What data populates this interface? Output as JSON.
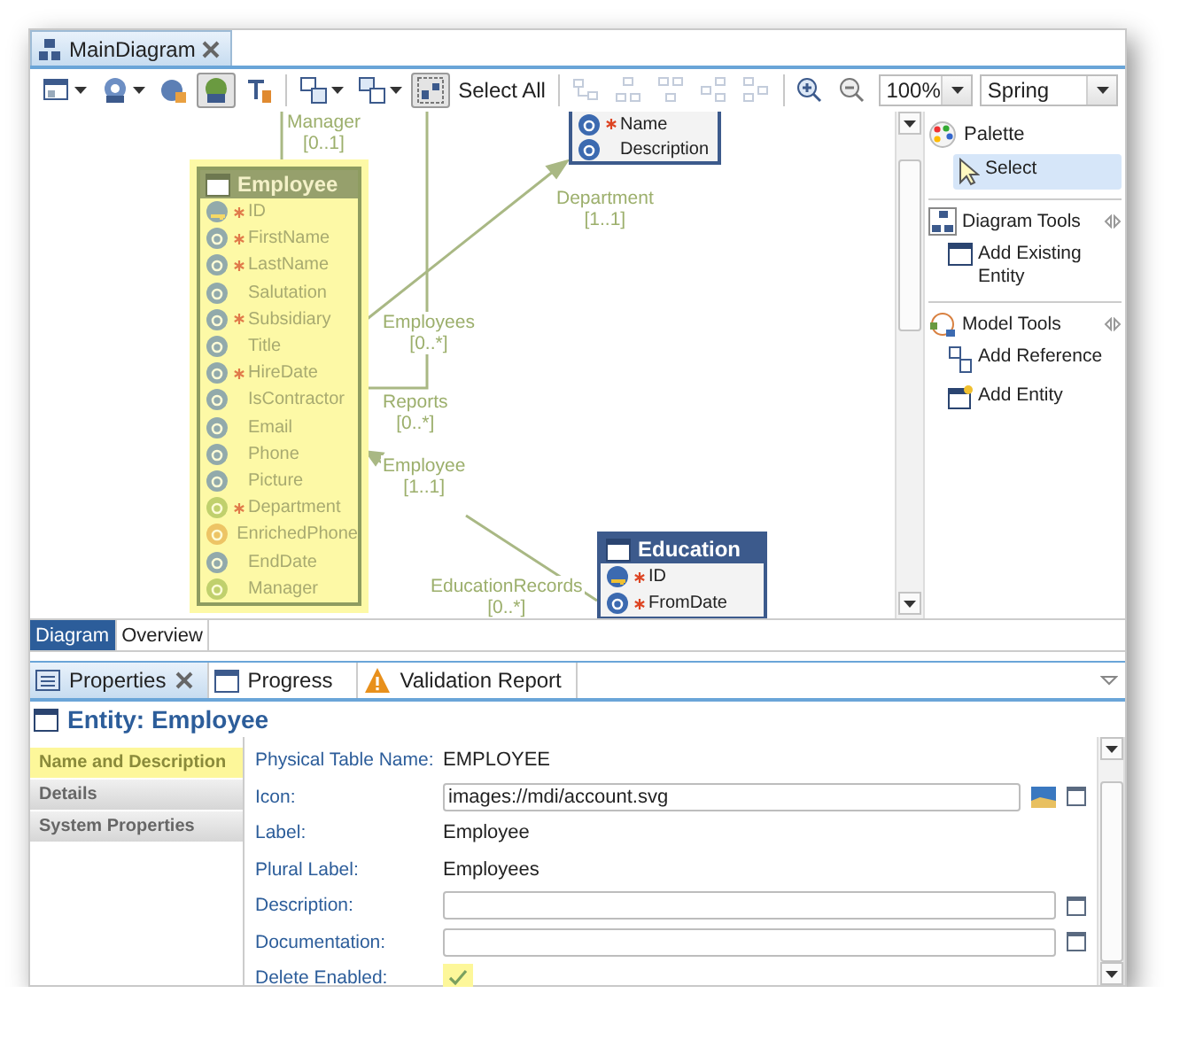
{
  "editor_tabs": [
    {
      "label": "MainDiagram",
      "selected": true,
      "closable": true
    }
  ],
  "toolbar": {
    "tools": [
      {
        "kind": "icon",
        "menu": true,
        "pressed": false,
        "disabled": false
      },
      {
        "kind": "icon",
        "menu": true,
        "pressed": false,
        "disabled": false
      },
      {
        "kind": "icon",
        "menu": false,
        "pressed": false,
        "disabled": false
      },
      {
        "kind": "icon",
        "menu": false,
        "pressed": true,
        "disabled": false
      },
      {
        "kind": "icon",
        "menu": false,
        "pressed": false,
        "disabled": false
      },
      {
        "kind": "separator"
      },
      {
        "kind": "icon",
        "menu": true,
        "pressed": false,
        "disabled": false
      },
      {
        "kind": "icon",
        "menu": true,
        "pressed": false,
        "disabled": false
      },
      {
        "kind": "icon",
        "menu": false,
        "pressed": true,
        "disabled": false
      },
      {
        "kind": "text",
        "label": "Select All",
        "menu": false,
        "pressed": false,
        "disabled": false
      },
      {
        "kind": "separator"
      },
      {
        "kind": "icon",
        "menu": false,
        "pressed": false,
        "disabled": true
      },
      {
        "kind": "icon",
        "menu": false,
        "pressed": false,
        "disabled": true
      },
      {
        "kind": "icon",
        "menu": false,
        "pressed": false,
        "disabled": true
      },
      {
        "kind": "icon",
        "menu": false,
        "pressed": false,
        "disabled": true
      },
      {
        "kind": "icon",
        "menu": false,
        "pressed": false,
        "disabled": true
      },
      {
        "kind": "separator"
      },
      {
        "kind": "icon",
        "menu": false,
        "pressed": false,
        "disabled": false
      },
      {
        "kind": "icon",
        "menu": false,
        "pressed": false,
        "disabled": false
      }
    ],
    "zoom": {
      "value": "100%"
    },
    "layout": {
      "value": "Spring"
    }
  },
  "diagram": {
    "entities": [
      {
        "title": "Employee",
        "selected": true,
        "attributes": [
          {
            "name": "ID",
            "kind": "key",
            "required": true
          },
          {
            "name": "FirstName",
            "kind": "attribute",
            "required": true
          },
          {
            "name": "LastName",
            "kind": "attribute",
            "required": true
          },
          {
            "name": "Salutation",
            "kind": "attribute",
            "required": false
          },
          {
            "name": "Subsidiary",
            "kind": "attribute",
            "required": true
          },
          {
            "name": "Title",
            "kind": "attribute",
            "required": false
          },
          {
            "name": "HireDate",
            "kind": "attribute",
            "required": true
          },
          {
            "name": "IsContractor",
            "kind": "attribute",
            "required": false
          },
          {
            "name": "Email",
            "kind": "attribute",
            "required": false
          },
          {
            "name": "Phone",
            "kind": "attribute",
            "required": false
          },
          {
            "name": "Picture",
            "kind": "attribute",
            "required": false
          },
          {
            "name": "Department",
            "kind": "reference",
            "required": true
          },
          {
            "name": "EnrichedPhone",
            "kind": "computed",
            "required": false
          },
          {
            "name": "EndDate",
            "kind": "attribute",
            "required": false
          },
          {
            "name": "Manager",
            "kind": "reference",
            "required": false
          }
        ]
      },
      {
        "selected": false,
        "attributes": [
          {
            "name": "Name",
            "kind": "attribute",
            "required": true
          },
          {
            "name": "Description",
            "kind": "attribute",
            "required": false
          }
        ]
      },
      {
        "title": "Education",
        "selected": false,
        "attributes": [
          {
            "name": "ID",
            "kind": "key",
            "required": true
          },
          {
            "name": "FromDate",
            "kind": "attribute",
            "required": true
          }
        ]
      }
    ],
    "relations": [
      {
        "name": "Manager",
        "multiplicity": "[0..1]"
      },
      {
        "name": "Department",
        "multiplicity": "[1..1]"
      },
      {
        "name": "Employees",
        "multiplicity": "[0..*]"
      },
      {
        "name": "Reports",
        "multiplicity": "[0..*]"
      },
      {
        "name": "Employee",
        "multiplicity": "[1..1]"
      },
      {
        "name": "EducationRecords",
        "multiplicity": "[0..*]"
      }
    ]
  },
  "palette": {
    "title": "Palette",
    "items": [
      {
        "label": "Select",
        "selected": true
      }
    ],
    "drawers": [
      {
        "title": "Diagram Tools",
        "items": [
          {
            "label": "Add Existing Entity"
          }
        ]
      },
      {
        "title": "Model Tools",
        "items": [
          {
            "label": "Add Reference"
          },
          {
            "label": "Add Entity"
          }
        ]
      }
    ]
  },
  "diagram_tabs": [
    {
      "label": "Diagram",
      "selected": true
    },
    {
      "label": "Overview",
      "selected": false
    }
  ],
  "view_tabs": [
    {
      "label": "Properties",
      "selected": true,
      "closable": true
    },
    {
      "label": "Progress",
      "selected": false,
      "closable": false
    },
    {
      "label": "Validation Report",
      "selected": false,
      "closable": false
    }
  ],
  "properties": {
    "title": "Entity: Employee",
    "sections": [
      {
        "label": "Name and Description",
        "selected": true
      },
      {
        "label": "Details",
        "selected": false
      },
      {
        "label": "System Properties",
        "selected": false
      }
    ],
    "fields": [
      {
        "label": "Physical Table Name:",
        "kind": "text",
        "value": "EMPLOYEE"
      },
      {
        "label": "Icon:",
        "kind": "image-input",
        "value": "images://mdi/account.svg"
      },
      {
        "label": "Label:",
        "kind": "text",
        "value": "Employee"
      },
      {
        "label": "Plural Label:",
        "kind": "text",
        "value": "Employees"
      },
      {
        "label": "Description:",
        "kind": "input"
      },
      {
        "label": "Documentation:",
        "kind": "input"
      },
      {
        "label": "Delete Enabled:",
        "kind": "checkbox",
        "checked": true
      }
    ]
  }
}
